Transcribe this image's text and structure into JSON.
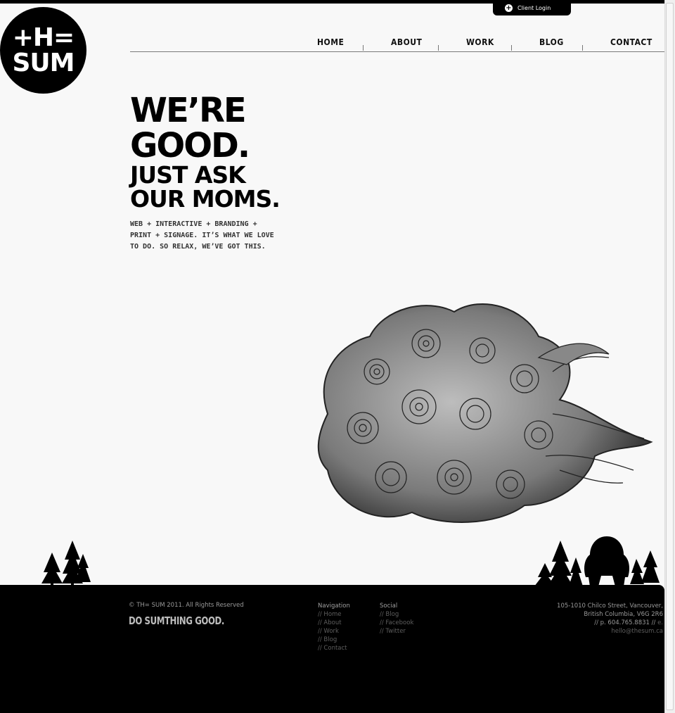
{
  "client_login": {
    "label": "Client Login",
    "icon": "plus-circle-icon"
  },
  "logo": {
    "line1": "+H=",
    "line2": "SUM"
  },
  "nav": {
    "items": [
      "HOME",
      "ABOUT",
      "WORK",
      "BLOG",
      "CONTACT"
    ]
  },
  "hero": {
    "headline_1": "WE’RE",
    "headline_2": "GOOD.",
    "headline_3": "JUST ASK",
    "headline_4": "OUR MOMS.",
    "tagline": "WEB + INTERACTIVE + BRANDING + PRINT + SIGNAGE. IT’S WHAT WE LOVE TO DO. SO RELAX, WE’VE GOT THIS."
  },
  "footer": {
    "copyright": "© TH= SUM 2011. All Rights Reserved",
    "slogan": "DO SUMTHING GOOD.",
    "navigation": {
      "title": "Navigation",
      "links": [
        "// Home",
        "// About",
        "// Work",
        "// Blog",
        "// Contact"
      ]
    },
    "social": {
      "title": "Social",
      "links": [
        "// Blog",
        "// Facebook",
        "// Twitter"
      ]
    },
    "address": {
      "line1": "105-1010 Chilco Street, Vancouver,",
      "line2": "British Columbia, V6G 2R6",
      "line3": "// p. 604.765.8831 //",
      "line3_suffix": "e.",
      "email": "hello@thesum.ca"
    }
  },
  "colors": {
    "background": "#f8f8f8",
    "footer": "#000000",
    "accent": "#000000"
  }
}
